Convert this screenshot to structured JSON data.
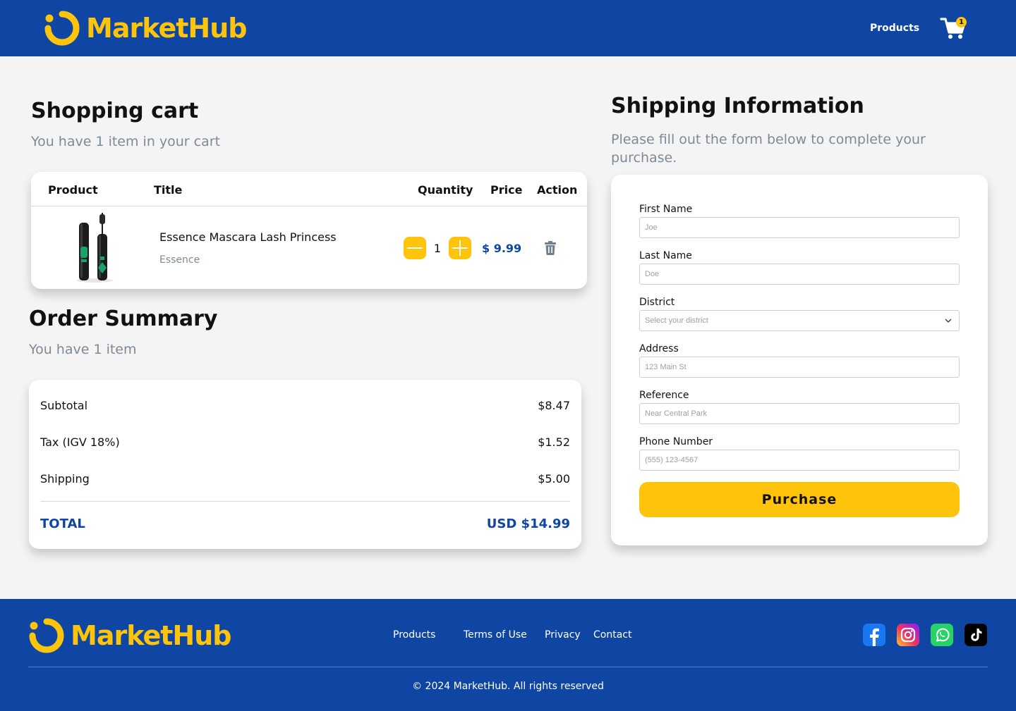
{
  "brand": {
    "name": "MarketHub",
    "color": "#fec40c",
    "primary": "#0f46a3"
  },
  "header": {
    "nav_products": "Products",
    "cart_count": "1",
    "cart_icon": "cart-icon"
  },
  "cart": {
    "title": "Shopping cart",
    "subtitle": "You have 1 item in your cart",
    "columns": {
      "product": "Product",
      "title": "Title",
      "quantity": "Quantity",
      "price": "Price",
      "action": "Action"
    },
    "item": {
      "name": "Essence Mascara Lash Princess",
      "brand": "Essence",
      "quantity": "1",
      "price": "$ 9.99"
    }
  },
  "summary": {
    "title": "Order Summary",
    "subtitle": "You have 1 item",
    "subtotal_label": "Subtotal",
    "subtotal_value": "$8.47",
    "tax_label": "Tax (IGV 18%)",
    "tax_value": "$1.52",
    "shipping_label": "Shipping",
    "shipping_value": "$5.00",
    "total_label": "TOTAL",
    "total_value": "USD $14.99"
  },
  "shipping": {
    "title": "Shipping Information",
    "subtitle": "Please fill out the form below to complete your purchase.",
    "first_name_label": "First Name",
    "first_name_placeholder": "Joe",
    "last_name_label": "Last Name",
    "last_name_placeholder": "Doe",
    "district_label": "District",
    "district_placeholder": "Select your district",
    "address_label": "Address",
    "address_placeholder": "123 Main St",
    "reference_label": "Reference",
    "reference_placeholder": "Near Central Park",
    "phone_label": "Phone Number",
    "phone_placeholder": "(555) 123-4567",
    "purchase_label": "Purchase"
  },
  "footer": {
    "links": [
      "Products",
      "Terms of Use",
      "Privacy",
      "Contact"
    ],
    "social": [
      "facebook-icon",
      "instagram-icon",
      "whatsapp-icon",
      "tiktok-icon"
    ],
    "copyright": "© 2024 MarketHub. All rights reserved"
  }
}
